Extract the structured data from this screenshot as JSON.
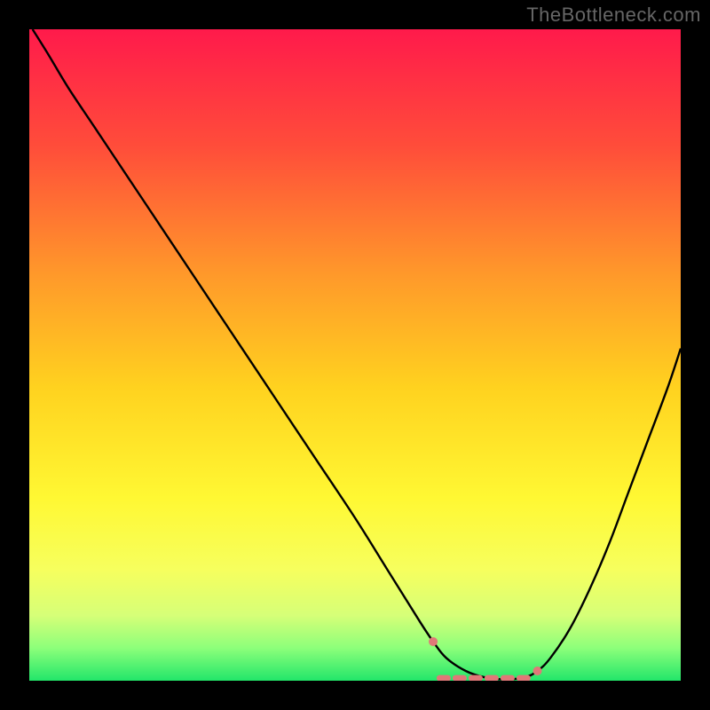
{
  "attribution": "TheBottleneck.com",
  "chart_data": {
    "type": "line",
    "title": "",
    "xlabel": "",
    "ylabel": "",
    "xlim": [
      0,
      100
    ],
    "ylim": [
      0,
      100
    ],
    "grid": false,
    "legend": false,
    "background_gradient_stops": [
      {
        "offset": 0,
        "color": "#ff1a4b"
      },
      {
        "offset": 18,
        "color": "#ff4d3a"
      },
      {
        "offset": 38,
        "color": "#ff9a2a"
      },
      {
        "offset": 55,
        "color": "#ffd21f"
      },
      {
        "offset": 72,
        "color": "#fff833"
      },
      {
        "offset": 83,
        "color": "#f6ff5e"
      },
      {
        "offset": 90,
        "color": "#d6ff78"
      },
      {
        "offset": 95,
        "color": "#8cff7a"
      },
      {
        "offset": 100,
        "color": "#22e66a"
      }
    ],
    "series": [
      {
        "name": "bottleneck-curve",
        "color": "#000000",
        "width": 2.4,
        "x": [
          0.5,
          3,
          6,
          10,
          15,
          20,
          26,
          32,
          38,
          44,
          50,
          55,
          60,
          62,
          64,
          67,
          70,
          73,
          76,
          78,
          80,
          83,
          86,
          89,
          92,
          95,
          98,
          100
        ],
        "y": [
          100,
          96,
          91,
          85,
          77.5,
          70,
          61,
          52,
          43,
          34,
          25,
          17,
          9,
          6,
          3.5,
          1.5,
          0.5,
          0.2,
          0.5,
          1.5,
          3.5,
          8,
          14,
          21,
          29,
          37,
          45,
          51
        ]
      }
    ],
    "markers": {
      "name": "highlight-segment",
      "color": "#e07878",
      "radius": 5,
      "dash_width": 7,
      "x": [
        62,
        78
      ],
      "y": [
        6,
        1.5
      ]
    }
  }
}
